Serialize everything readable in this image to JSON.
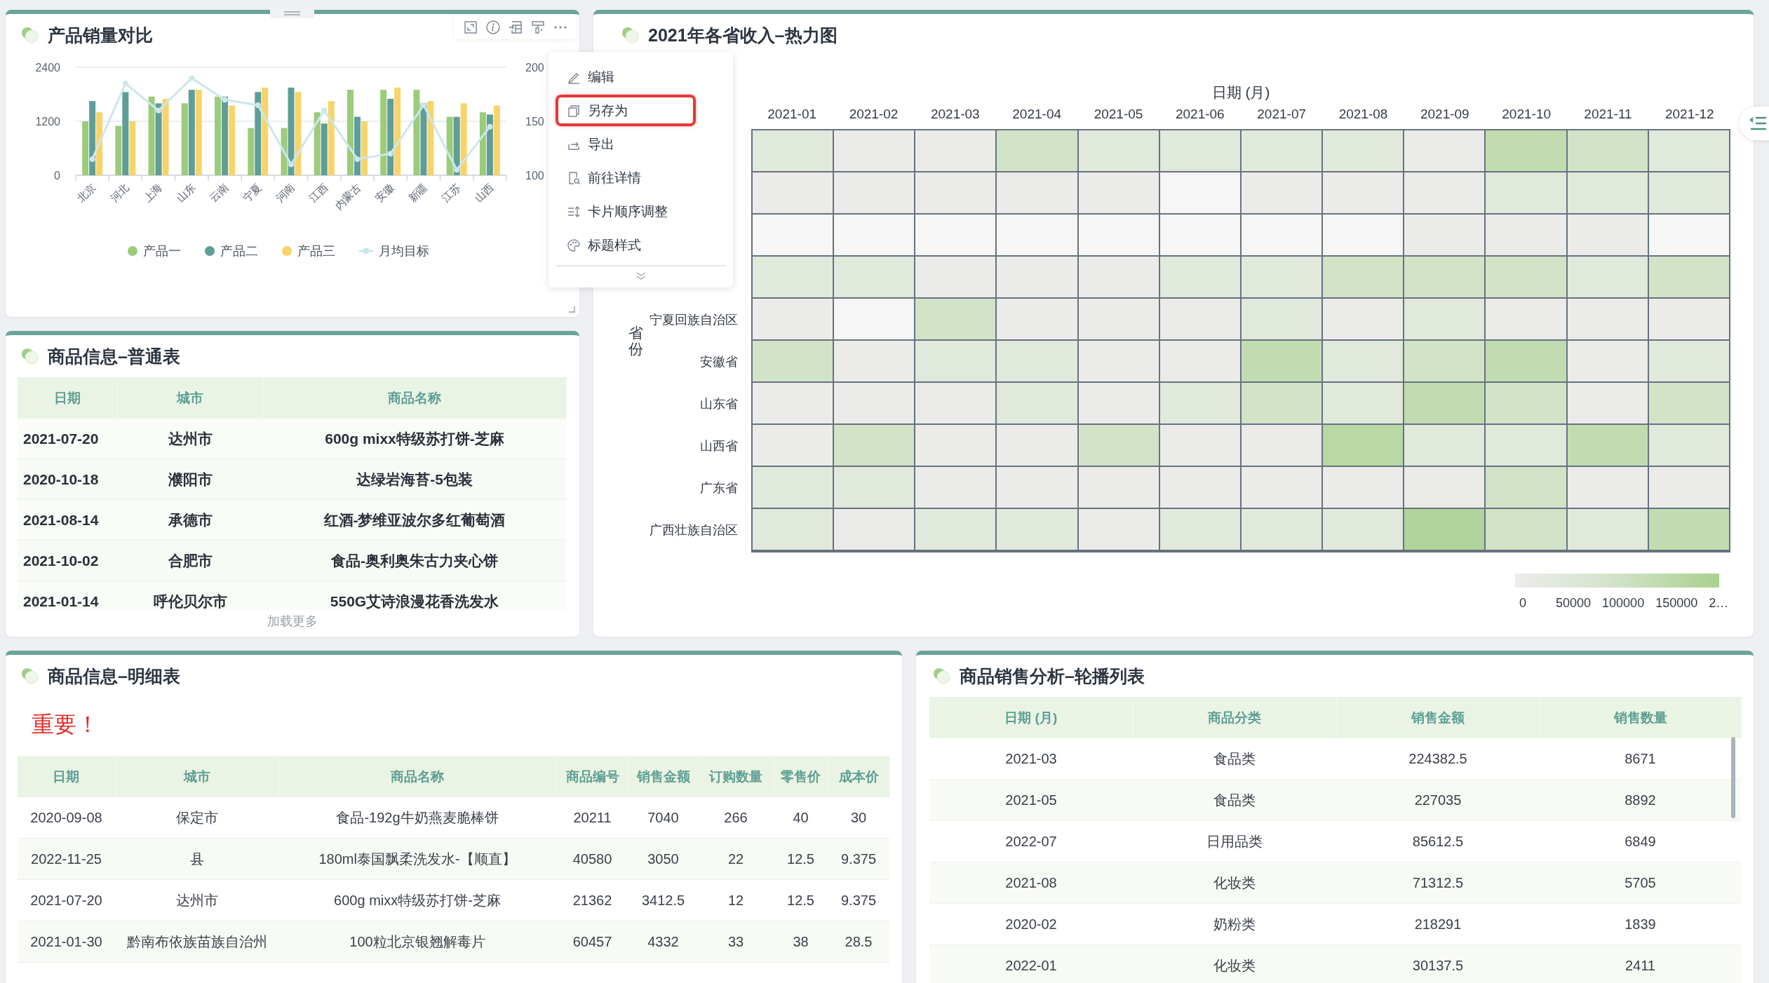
{
  "sales_chart_card": {
    "title": "产品销量对比",
    "chart_data": {
      "type": "bar",
      "stacked": false,
      "categories": [
        "北京",
        "河北",
        "上海",
        "山东",
        "云南",
        "宁夏",
        "河南",
        "江西",
        "内蒙古",
        "安徽",
        "新疆",
        "江苏",
        "山西"
      ],
      "ylim": [
        0,
        2400
      ],
      "yticks": [
        0,
        1200,
        2400
      ],
      "y2lim": [
        100,
        200
      ],
      "y2ticks": [
        100,
        150,
        200
      ],
      "series": [
        {
          "name": "产品一",
          "color": "#9ccb7c",
          "values": [
            1200,
            1100,
            1750,
            1600,
            1750,
            1050,
            1050,
            1400,
            1900,
            1900,
            1900,
            1300,
            1400
          ]
        },
        {
          "name": "产品二",
          "color": "#5f9e98",
          "values": [
            1650,
            1850,
            1600,
            1900,
            1750,
            1850,
            1950,
            1150,
            1300,
            1700,
            1600,
            1300,
            1350
          ]
        },
        {
          "name": "产品三",
          "color": "#f7d46a",
          "values": [
            1400,
            1200,
            1700,
            1900,
            1550,
            1950,
            1850,
            1650,
            1200,
            1950,
            1650,
            1600,
            1550
          ]
        },
        {
          "name": "月均目标",
          "type": "line",
          "axis": "y2",
          "marker": true,
          "color": "#cde7ea",
          "values": [
            115,
            185,
            160,
            190,
            170,
            165,
            110,
            160,
            115,
            120,
            165,
            105,
            145
          ]
        }
      ]
    }
  },
  "heatmap_card": {
    "title": "2021年各省收入–热力图",
    "x_title": "日期 (月)",
    "y_title": "省份",
    "columns": [
      "2021-01",
      "2021-02",
      "2021-03",
      "2021-04",
      "2021-05",
      "2021-06",
      "2021-07",
      "2021-08",
      "2021-09",
      "2021-10",
      "2021-11",
      "2021-12"
    ],
    "rows": [
      {
        "cells": [
          {
            "color": "#e1e8dc"
          },
          {
            "color": "#ebebe9"
          },
          {
            "color": "#ebebe9"
          },
          {
            "color": "#d2e3c8"
          },
          {
            "color": "#e1e8dc"
          },
          {
            "color": "#e1e8dc"
          },
          {
            "color": "#e1e8dc"
          },
          {
            "color": "#e1e8dc"
          },
          {
            "color": "#ebebe9"
          },
          {
            "color": "#c2dcb2"
          },
          {
            "color": "#d2e3c8"
          },
          {
            "color": "#e1e8dc"
          }
        ]
      },
      {
        "cells": [
          {
            "color": "#ebebe9"
          },
          {
            "color": "#ebebe9"
          },
          {
            "color": "#ebebe9"
          },
          {
            "color": "#ebebe9"
          },
          {
            "color": "#ebebe9"
          },
          {
            "color": "#f6f6f6"
          },
          {
            "color": "#ebebe9"
          },
          {
            "color": "#ebebe9"
          },
          {
            "color": "#ebebe9"
          },
          {
            "color": "#e1e8dc"
          },
          {
            "color": "#e1e8dc"
          },
          {
            "color": "#e1e8dc"
          }
        ]
      },
      {
        "cells": [
          {
            "color": "#f6f6f6"
          },
          {
            "color": "#f6f6f6"
          },
          {
            "color": "#f6f6f6"
          },
          {
            "color": "#f6f6f6"
          },
          {
            "color": "#f6f6f6"
          },
          {
            "color": "#f6f6f6"
          },
          {
            "color": "#f6f6f6"
          },
          {
            "color": "#f6f6f6"
          },
          {
            "color": "#ebebe9"
          },
          {
            "color": "#ebebe9"
          },
          {
            "color": "#ebebe9"
          },
          {
            "color": "#f6f6f6"
          }
        ]
      },
      {
        "cells": [
          {
            "color": "#e1e8dc"
          },
          {
            "color": "#e1e8dc"
          },
          {
            "color": "#ebebe9"
          },
          {
            "color": "#ebebe9"
          },
          {
            "color": "#ebebe9"
          },
          {
            "color": "#e1e8dc"
          },
          {
            "color": "#e1e8dc"
          },
          {
            "color": "#d2e3c8"
          },
          {
            "color": "#d2e3c8"
          },
          {
            "color": "#d2e3c8"
          },
          {
            "color": "#e1e8dc"
          },
          {
            "color": "#d2e3c8"
          }
        ]
      },
      {
        "label": "宁夏回族自治区",
        "cells": [
          {
            "color": "#ebebe9"
          },
          {
            "color": "#f6f6f6"
          },
          {
            "color": "#d2e3c8"
          },
          {
            "color": "#ebebe9"
          },
          {
            "color": "#ebebe9"
          },
          {
            "color": "#ebebe9"
          },
          {
            "color": "#e1e8dc"
          },
          {
            "color": "#ebebe9"
          },
          {
            "color": "#e1e8dc"
          },
          {
            "color": "#ebebe9"
          },
          {
            "color": "#ebebe9"
          },
          {
            "color": "#ebebe9"
          }
        ]
      },
      {
        "label": "安徽省",
        "cells": [
          {
            "color": "#d2e3c8"
          },
          {
            "color": "#ebebe9"
          },
          {
            "color": "#e1e8dc"
          },
          {
            "color": "#e1e8dc"
          },
          {
            "color": "#ebebe9"
          },
          {
            "color": "#ebebe9"
          },
          {
            "color": "#c2dcb2"
          },
          {
            "color": "#e1e8dc"
          },
          {
            "color": "#d2e3c8"
          },
          {
            "color": "#c2dcb2"
          },
          {
            "color": "#ebebe9"
          },
          {
            "color": "#e1e8dc"
          }
        ]
      },
      {
        "label": "山东省",
        "cells": [
          {
            "color": "#ebebe9"
          },
          {
            "color": "#ebebe9"
          },
          {
            "color": "#ebebe9"
          },
          {
            "color": "#e1e8dc"
          },
          {
            "color": "#ebebe9"
          },
          {
            "color": "#e1e8dc"
          },
          {
            "color": "#d2e3c8"
          },
          {
            "color": "#e1e8dc"
          },
          {
            "color": "#c2dcb2"
          },
          {
            "color": "#d2e3c8"
          },
          {
            "color": "#ebebe9"
          },
          {
            "color": "#d2e3c8"
          }
        ]
      },
      {
        "label": "山西省",
        "cells": [
          {
            "color": "#ebebe9"
          },
          {
            "color": "#d2e3c8"
          },
          {
            "color": "#ebebe9"
          },
          {
            "color": "#ebebe9"
          },
          {
            "color": "#d2e3c8"
          },
          {
            "color": "#ebebe9"
          },
          {
            "color": "#ebebe9"
          },
          {
            "color": "#b8d8a4"
          },
          {
            "color": "#e1e8dc"
          },
          {
            "color": "#e1e8dc"
          },
          {
            "color": "#c2dcb2"
          },
          {
            "color": "#e1e8dc"
          }
        ]
      },
      {
        "label": "广东省",
        "cells": [
          {
            "color": "#e1e8dc"
          },
          {
            "color": "#e1e8dc"
          },
          {
            "color": "#ebebe9"
          },
          {
            "color": "#ebebe9"
          },
          {
            "color": "#ebebe9"
          },
          {
            "color": "#ebebe9"
          },
          {
            "color": "#ebebe9"
          },
          {
            "color": "#ebebe9"
          },
          {
            "color": "#ebebe9"
          },
          {
            "color": "#d2e3c8"
          },
          {
            "color": "#ebebe9"
          },
          {
            "color": "#ebebe9"
          }
        ]
      },
      {
        "label": "广西壮族自治区",
        "cells": [
          {
            "color": "#e1e8dc"
          },
          {
            "color": "#ebebe9"
          },
          {
            "color": "#e1e8dc"
          },
          {
            "color": "#e1e8dc"
          },
          {
            "color": "#ebebe9"
          },
          {
            "color": "#e1e8dc"
          },
          {
            "color": "#e1e8dc"
          },
          {
            "color": "#e1e8dc"
          },
          {
            "color": "#b1d39c"
          },
          {
            "color": "#d2e3c8"
          },
          {
            "color": "#e1e8dc"
          },
          {
            "color": "#c2dcb2"
          }
        ]
      }
    ],
    "legend_labels": [
      "0",
      "50000",
      "100000",
      "150000",
      "2…"
    ]
  },
  "context_menu": {
    "items": [
      {
        "kind": "edit",
        "label": "编辑",
        "highlighted": false
      },
      {
        "kind": "save-as",
        "label": "另存为",
        "highlighted": true
      },
      {
        "kind": "export",
        "label": "导出",
        "highlighted": false
      },
      {
        "kind": "details",
        "label": "前往详情",
        "highlighted": false
      },
      {
        "kind": "reorder",
        "label": "卡片顺序调整",
        "highlighted": false
      },
      {
        "kind": "title-style",
        "label": "标题样式",
        "highlighted": false
      }
    ]
  },
  "basic_table_card": {
    "title": "商品信息–普通表",
    "columns": [
      "日期",
      "城市",
      "商品名称"
    ],
    "rows": [
      [
        "2021-07-20",
        "达州市",
        "600g mixx特级苏打饼-芝麻"
      ],
      [
        "2020-10-18",
        "濮阳市",
        "达绿岩海苔-5包装"
      ],
      [
        "2021-08-14",
        "承德市",
        "红酒-梦维亚波尔多红葡萄酒"
      ],
      [
        "2021-10-02",
        "合肥市",
        "食品-奥利奥朱古力夹心饼"
      ],
      [
        "2021-01-14",
        "呼伦贝尔市",
        "550G艾诗浪漫花香洗发水"
      ]
    ],
    "load_more": "加载更多"
  },
  "detail_table_card": {
    "title": "商品信息–明细表",
    "notice": "重要！",
    "columns": [
      "日期",
      "城市",
      "商品名称",
      "商品编号",
      "销售金额",
      "订购数量",
      "零售价",
      "成本价"
    ],
    "rows": [
      [
        "2020-09-08",
        "保定市",
        "食品-192g牛奶燕麦脆棒饼",
        "20211",
        "7040",
        "266",
        "40",
        "30"
      ],
      [
        "2022-11-25",
        "县",
        "180ml泰国飘柔洗发水-【顺直】",
        "40580",
        "3050",
        "22",
        "12.5",
        "9.375"
      ],
      [
        "2021-07-20",
        "达州市",
        "600g mixx特级苏打饼-芝麻",
        "21362",
        "3412.5",
        "12",
        "12.5",
        "9.375"
      ],
      [
        "2021-01-30",
        "黔南布依族苗族自治州",
        "100粒北京银翘解毒片",
        "60457",
        "4332",
        "33",
        "38",
        "28.5"
      ]
    ]
  },
  "carousel_table_card": {
    "title": "商品销售分析–轮播列表",
    "columns": [
      "日期 (月)",
      "商品分类",
      "销售金额",
      "销售数量"
    ],
    "rows": [
      [
        "2021-03",
        "食品类",
        "224382.5",
        "8671"
      ],
      [
        "2021-05",
        "食品类",
        "227035",
        "8892"
      ],
      [
        "2022-07",
        "日用品类",
        "85612.5",
        "6849"
      ],
      [
        "2021-08",
        "化妆类",
        "71312.5",
        "5705"
      ],
      [
        "2020-02",
        "奶粉类",
        "218291",
        "1839"
      ],
      [
        "2022-01",
        "化妆类",
        "30137.5",
        "2411"
      ]
    ]
  }
}
